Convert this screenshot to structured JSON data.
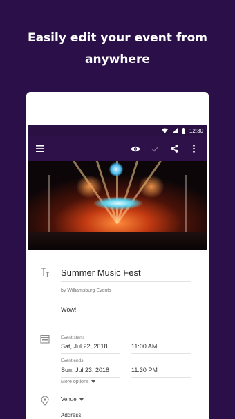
{
  "headline": {
    "line1": "Easily edit your event from",
    "line2": "anywhere"
  },
  "status_bar": {
    "time": "12:30",
    "icons": [
      "wifi-icon",
      "signal-icon",
      "battery-icon"
    ]
  },
  "toolbar": {
    "icons": [
      "menu-icon",
      "eye-icon",
      "check-icon",
      "share-icon",
      "more-vert-icon"
    ]
  },
  "event": {
    "title": "Summer Music Fest",
    "organizer": "by Williamsburg Events",
    "description": "Wow!",
    "starts_label": "Event starts",
    "start_date": "Sat, Jul 22, 2018",
    "start_time": "11:00 AM",
    "ends_label": "Event ends",
    "end_date": "Sun, Jul 23, 2018",
    "end_time": "11:30 PM",
    "more_options": "More options",
    "venue_label": "Venue",
    "address_label": "Address"
  },
  "colors": {
    "background": "#2a0f48",
    "toolbar": "#2d1148",
    "card": "#ffffff"
  }
}
